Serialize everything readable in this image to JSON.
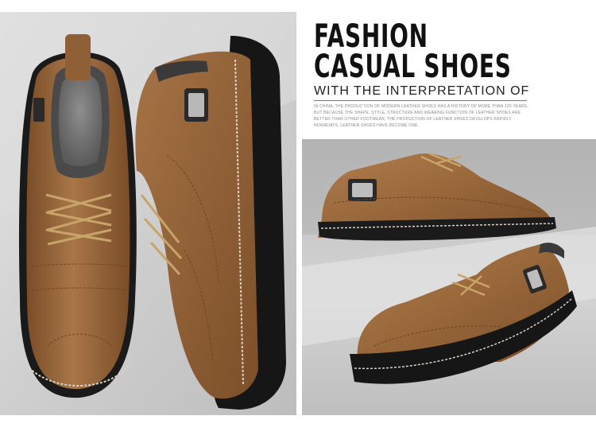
{
  "headline": {
    "line1": "FASHION",
    "line2": "CASUAL SHOES",
    "subtitle": "WITH THE INTERPRETATION OF"
  },
  "body_copy": "IN CHINA, THE PRODUCTION OF MODERN LEATHER SHOES HAS A HISTORY OF MORE THAN 120 YEARS, BUT BECAUSE THE SHAPE, STYLE, STRUCTURE AND WEARING FUNCTION OF LEATHER SHOES ARE BETTER THAN OTHER FOOTWEAR, THE PRODUCTION OF LEATHER SHOES DEVELOPS RAPIDLY. NOWADAYS, LEATHER SHOES HAVE BECOME ONE",
  "colors": {
    "leather": "#9a6a3c",
    "leather_dark": "#6e4522",
    "sole": "#1c1c1c",
    "background_gray": "#d4d4d4"
  }
}
